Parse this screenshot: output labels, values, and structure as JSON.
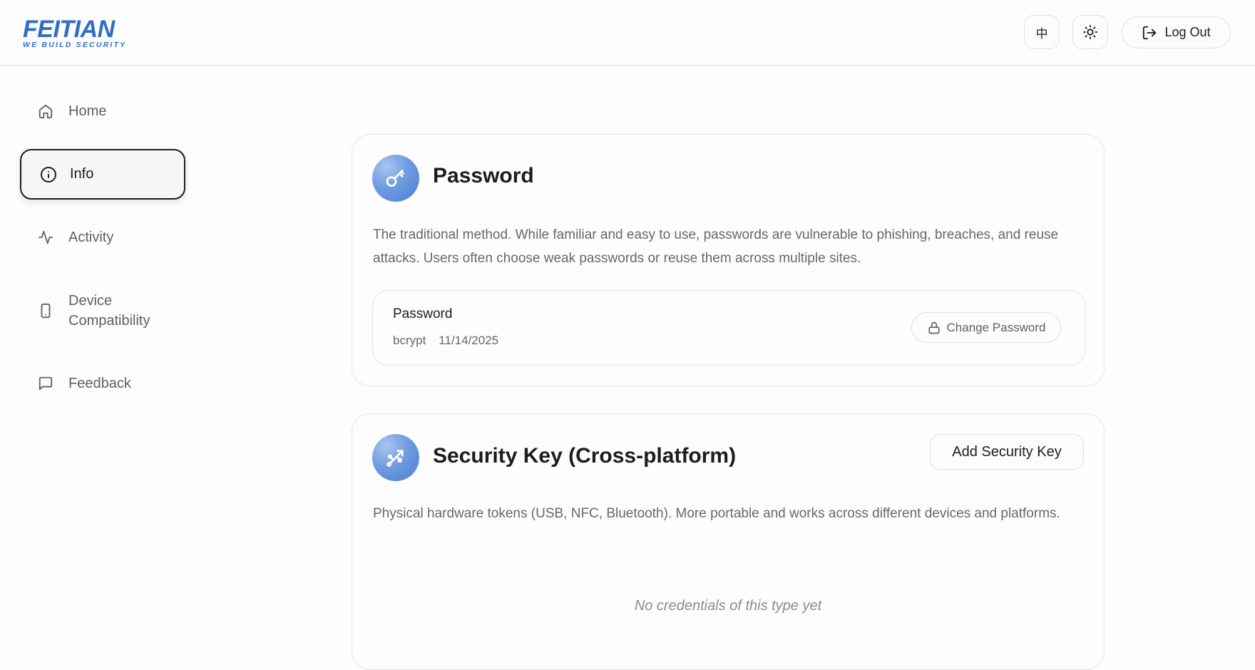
{
  "header": {
    "logo": {
      "main": "FEITIAN",
      "sub": "WE  BUILD  SECURITY"
    },
    "lang_label": "中",
    "theme_icon": "sun-icon",
    "logout_label": "Log Out",
    "logout_icon": "log-out-icon"
  },
  "sidebar": {
    "items": [
      {
        "label": "Home",
        "icon": "home-icon",
        "active": false
      },
      {
        "label": "Info",
        "icon": "info-icon",
        "active": true
      },
      {
        "label": "Activity",
        "icon": "activity-icon",
        "active": false
      },
      {
        "label": "Device Compatibility",
        "icon": "smartphone-icon",
        "active": false
      },
      {
        "label": "Feedback",
        "icon": "message-square-icon",
        "active": false
      }
    ]
  },
  "main": {
    "password_card": {
      "title": "Password",
      "icon": "key-icon",
      "description": "The traditional method. While familiar and easy to use, passwords are vulnerable to phishing, breaches, and reuse attacks. Users often choose weak passwords or reuse them across multiple sites.",
      "credential": {
        "title": "Password",
        "algorithm": "bcrypt",
        "date": "11/14/2025",
        "action_label": "Change Password",
        "action_icon": "lock-icon"
      }
    },
    "security_key_card": {
      "title": "Security Key (Cross-platform)",
      "icon": "usb-icon",
      "add_label": "Add Security Key",
      "description": "Physical hardware tokens (USB, NFC, Bluetooth). More portable and works across different devices and platforms.",
      "empty_text": "No credentials of this type yet"
    }
  },
  "colors": {
    "brand": "#2f6fc4",
    "icon_gradient_start": "#a8c6ef",
    "icon_gradient_end": "#4a7fd4",
    "text_primary": "#1d1d1f",
    "text_secondary": "#67676e"
  }
}
